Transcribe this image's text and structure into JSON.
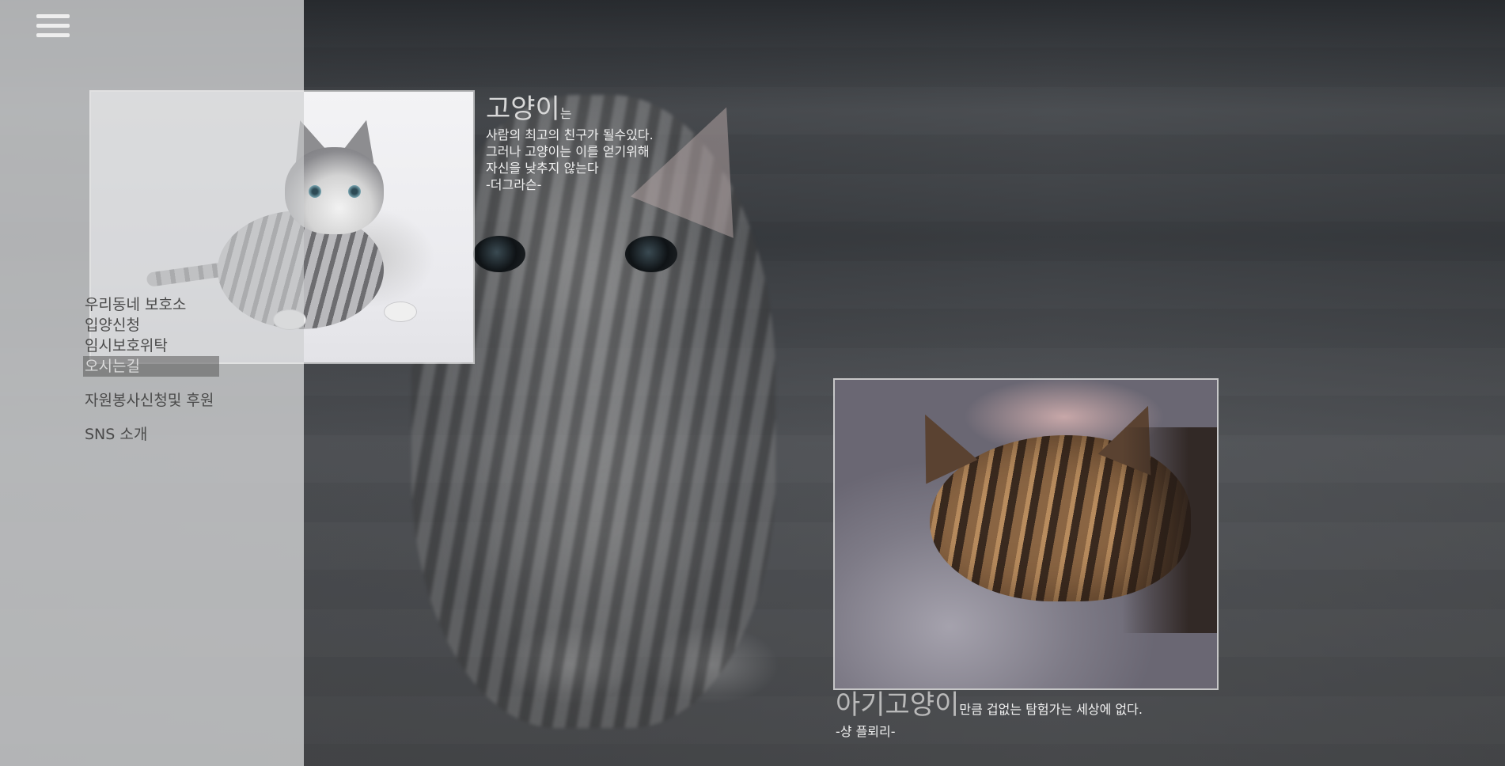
{
  "menu_icon": "hamburger-menu-icon",
  "menu": {
    "items": [
      {
        "label": "우리동네 보호소"
      },
      {
        "label": "입양신청"
      },
      {
        "label": "임시보호위탁"
      },
      {
        "label": "오시는길"
      },
      {
        "label": "자원봉사신청및 후원"
      },
      {
        "label": "SNS 소개"
      }
    ],
    "active_index": 3
  },
  "quote1": {
    "keyword": "고양이",
    "particle": "는",
    "body": "사람의 최고의 친구가 될수있다.\n그러나 고양이는 이를 얻기위해\n자신을 낮추지 않는다\n-더그라슨-"
  },
  "quote2": {
    "keyword": "아기고양이",
    "rest": "만큼 겁없는 탐험가는 세상에 없다.",
    "author": "-샹 플뢰리-"
  },
  "colors": {
    "sidebar": "#cdced0",
    "active_menu_bg": "#5a5a5a",
    "keyword_text": "#d8d8d8",
    "body_text": "#f1f1f1"
  }
}
